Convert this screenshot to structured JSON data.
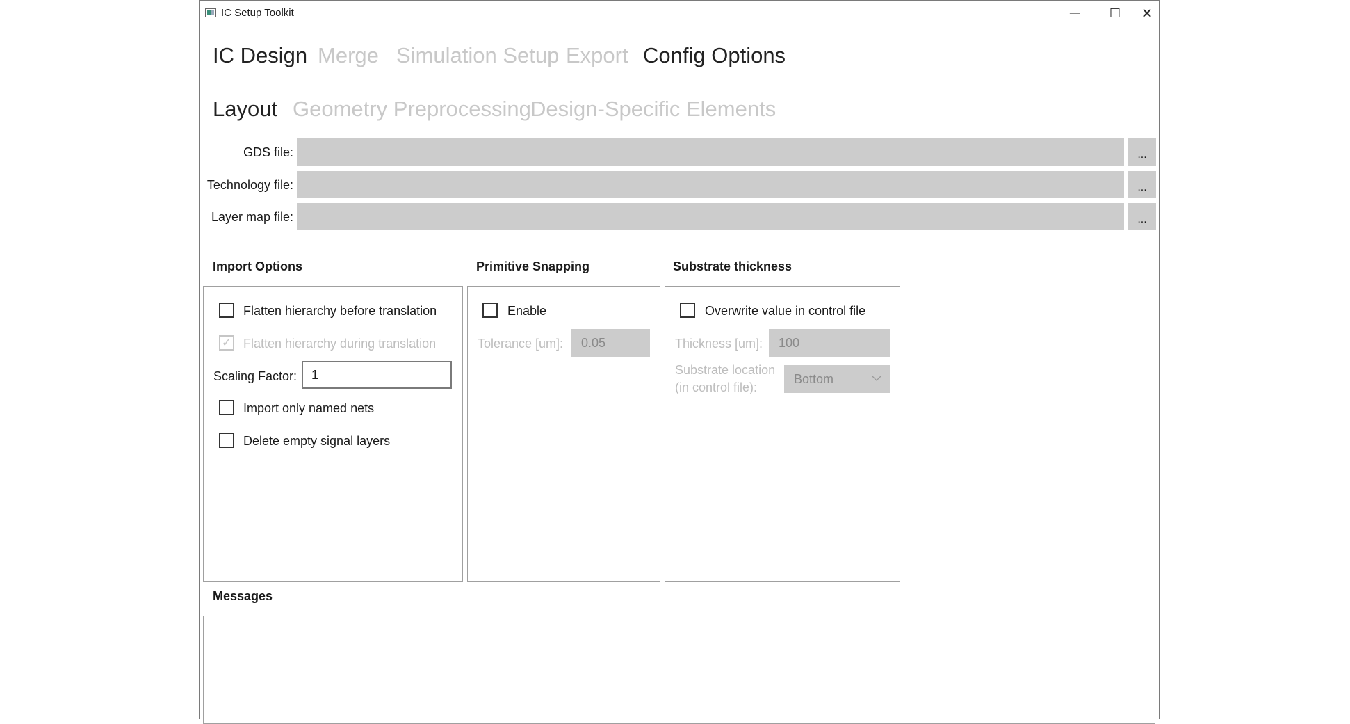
{
  "window": {
    "title": "IC Setup Toolkit",
    "controls": {
      "minimize": "─",
      "maximize": "☐",
      "close": "✕"
    }
  },
  "main_tabs": [
    {
      "label": "IC Design",
      "active": true
    },
    {
      "label": "Merge",
      "active": false
    },
    {
      "label": "Simulation Setup",
      "active": false
    },
    {
      "label": "Export",
      "active": false
    },
    {
      "label": "Config Options",
      "active": true
    }
  ],
  "sub_tabs": [
    {
      "label": "Layout",
      "active": true
    },
    {
      "label": "Geometry Preprocessing",
      "active": false
    },
    {
      "label": "Design-Specific Elements",
      "active": false
    }
  ],
  "files": [
    {
      "label": "GDS file:",
      "value": "",
      "browse": "..."
    },
    {
      "label": "Technology file:",
      "value": "",
      "browse": "..."
    },
    {
      "label": "Layer map file:",
      "value": "",
      "browse": "..."
    }
  ],
  "import_options": {
    "title": "Import Options",
    "flatten_before": {
      "label": "Flatten hierarchy before translation",
      "checked": false
    },
    "flatten_during": {
      "label": "Flatten hierarchy during translation",
      "checked": true,
      "disabled": true
    },
    "scaling_label": "Scaling Factor:",
    "scaling_value": "1",
    "named_nets": {
      "label": "Import only named nets",
      "checked": false
    },
    "delete_empty": {
      "label": "Delete empty signal layers",
      "checked": false
    }
  },
  "primitive_snapping": {
    "title": "Primitive Snapping",
    "enable": {
      "label": "Enable",
      "checked": false
    },
    "tolerance_label": "Tolerance [um]:",
    "tolerance_value": "0.05"
  },
  "substrate": {
    "title": "Substrate thickness",
    "overwrite": {
      "label": "Overwrite value in control file",
      "checked": false
    },
    "thickness_label": "Thickness [um]:",
    "thickness_value": "100",
    "location_label_1": "Substrate location",
    "location_label_2": "(in control file):",
    "location_value": "Bottom"
  },
  "messages": {
    "title": "Messages",
    "content": ""
  }
}
